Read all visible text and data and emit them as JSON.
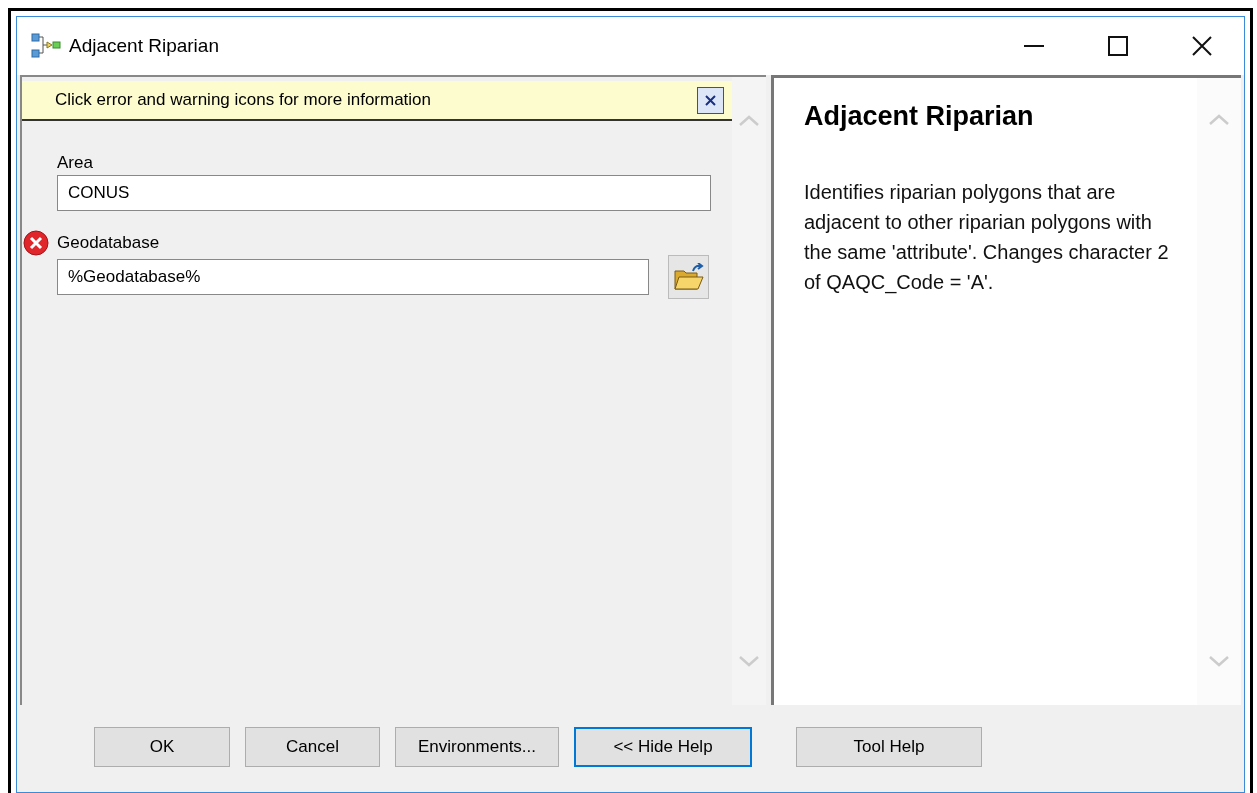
{
  "window": {
    "title": "Adjacent Riparian"
  },
  "message_bar": {
    "text": "Click error and warning icons for more information"
  },
  "parameters": [
    {
      "label": "Area",
      "value": "CONUS",
      "error": false,
      "browse": false
    },
    {
      "label": "Geodatabase",
      "value": "%Geodatabase%",
      "error": true,
      "browse": true
    }
  ],
  "help": {
    "title": "Adjacent Riparian",
    "text": "Identifies riparian polygons that are adjacent to other riparian polygons with the same 'attribute'. Changes character 2 of QAQC_Code = 'A'."
  },
  "buttons": [
    {
      "label": "OK",
      "focused": false
    },
    {
      "label": "Cancel",
      "focused": false
    },
    {
      "label": "Environments...",
      "focused": false
    },
    {
      "label": "<< Hide Help",
      "focused": true
    },
    {
      "label": "Tool Help",
      "focused": false
    }
  ]
}
